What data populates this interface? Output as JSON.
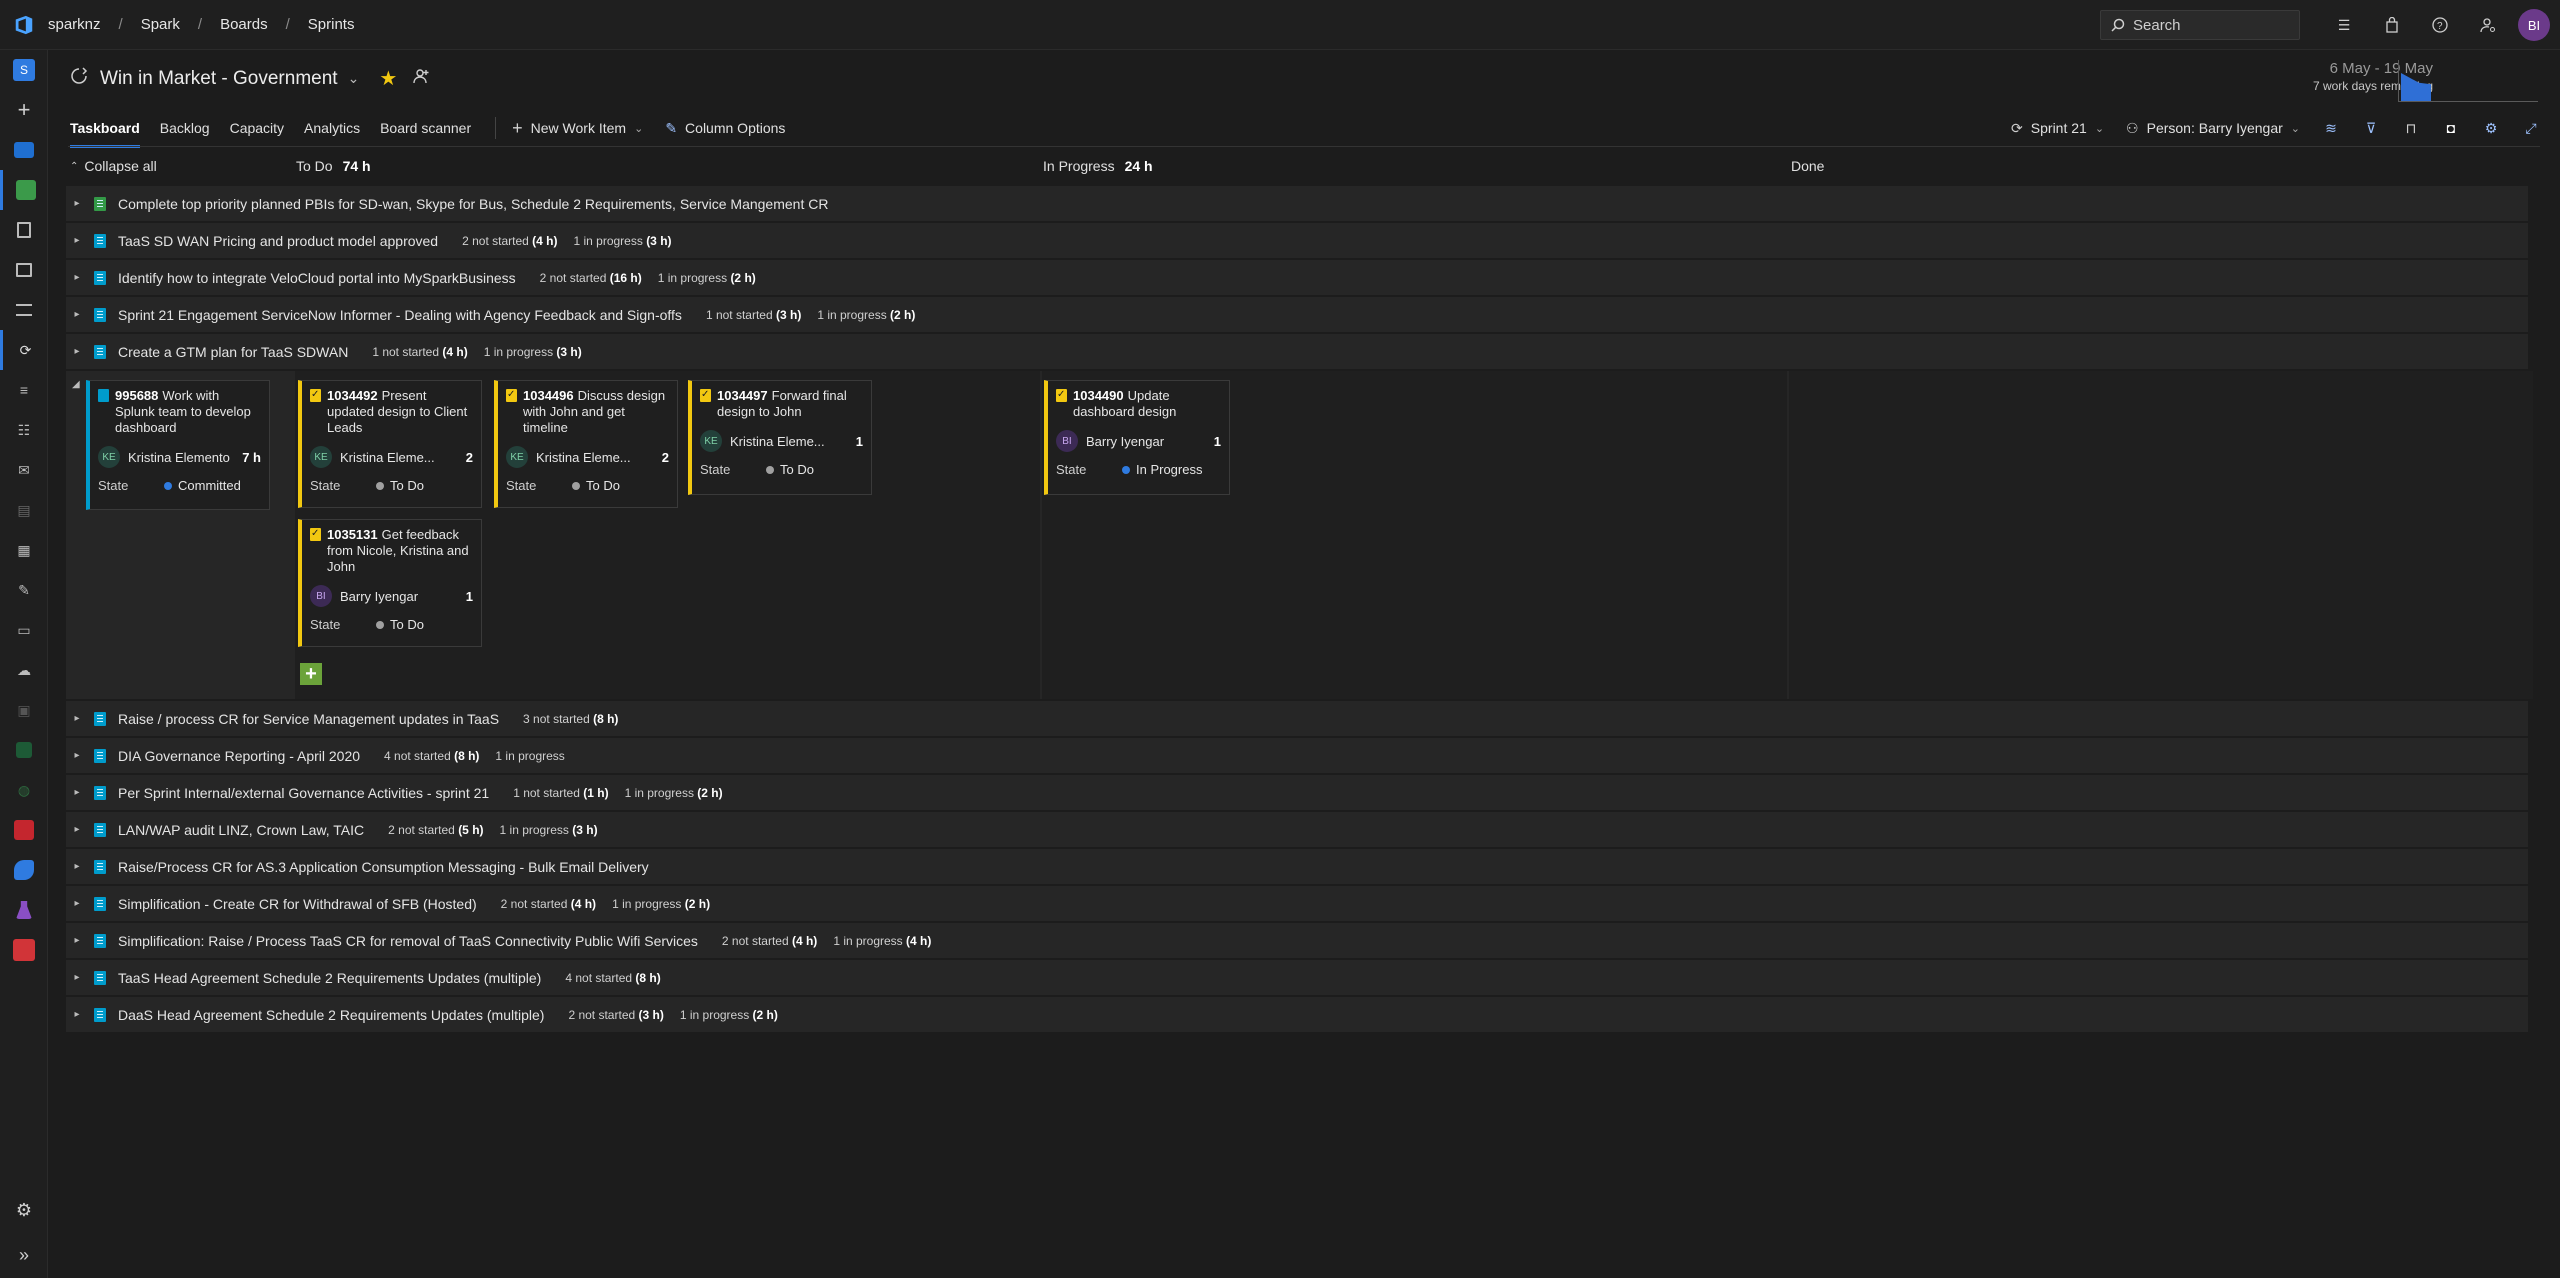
{
  "breadcrumb": {
    "org": "sparknz",
    "project": "Spark",
    "section": "Boards",
    "page": "Sprints"
  },
  "search": {
    "placeholder": "Search"
  },
  "user": {
    "initials": "BI"
  },
  "team": {
    "name": "Win in Market - Government"
  },
  "sprint_info": {
    "dates": "6 May - 19 May",
    "remaining": "7 work days remaining"
  },
  "tabs": [
    "Taskboard",
    "Backlog",
    "Capacity",
    "Analytics",
    "Board scanner"
  ],
  "toolbar": {
    "new_work_item": "New Work Item",
    "column_options": "Column Options",
    "sprint": "Sprint 21",
    "person": "Person: Barry Iyengar"
  },
  "columns": {
    "collapse_all": "Collapse all",
    "todo": {
      "label": "To Do",
      "hours": "74 h"
    },
    "inprogress": {
      "label": "In Progress",
      "hours": "24 h"
    },
    "done": {
      "label": "Done"
    }
  },
  "rows_before": [
    {
      "title": "Complete top priority planned PBIs for SD-wan, Skype for Bus, Schedule 2 Requirements, Service Mangement CR",
      "green": true,
      "ns": "",
      "nsh": "",
      "ip": "",
      "iph": ""
    },
    {
      "title": "TaaS SD WAN Pricing and product model approved",
      "ns": "2 not started",
      "nsh": "(4 h)",
      "ip": "1 in progress",
      "iph": "(3 h)"
    },
    {
      "title": "Identify how to integrate VeloCloud portal into MySparkBusiness",
      "ns": "2 not started",
      "nsh": "(16 h)",
      "ip": "1 in progress",
      "iph": "(2 h)"
    },
    {
      "title": "Sprint 21 Engagement ServiceNow Informer - Dealing with Agency Feedback and Sign-offs",
      "ns": "1 not started",
      "nsh": "(3 h)",
      "ip": "1 in progress",
      "iph": "(2 h)"
    },
    {
      "title": "Create a GTM plan for TaaS SDWAN",
      "ns": "1 not started",
      "nsh": "(4 h)",
      "ip": "1 in progress",
      "iph": "(3 h)"
    }
  ],
  "expanded": {
    "pbi": {
      "id": "995688",
      "title": "Work with Splunk team to develop dashboard",
      "initials": "KE",
      "assignee": "Kristina Elemento",
      "remaining": "7 h",
      "state_label": "State",
      "state": "Committed"
    },
    "tasks": [
      {
        "id": "1034492",
        "title": "Present updated design to Client Leads",
        "initials": "KE",
        "assignee": "Kristina Eleme...",
        "remaining": "2",
        "state_label": "State",
        "state": "To Do"
      },
      {
        "id": "1034496",
        "title": "Discuss design with John and get timeline",
        "initials": "KE",
        "assignee": "Kristina Eleme...",
        "remaining": "2",
        "state_label": "State",
        "state": "To Do"
      },
      {
        "id": "1034497",
        "title": "Forward final design to John",
        "initials": "KE",
        "assignee": "Kristina Eleme...",
        "remaining": "1",
        "state_label": "State",
        "state": "To Do"
      },
      {
        "id": "1035131",
        "title": "Get feedback from Nicole, Kristina and John",
        "initials": "BI",
        "assignee": "Barry Iyengar",
        "remaining": "1",
        "state_label": "State",
        "state": "To Do"
      },
      {
        "id": "1034490",
        "title": "Update dashboard design",
        "initials": "BI",
        "assignee": "Barry Iyengar",
        "remaining": "1",
        "state_label": "State",
        "state": "In Progress"
      }
    ]
  },
  "rows_after": [
    {
      "title": "Raise / process CR for Service Management updates in TaaS",
      "ns": "3 not started",
      "nsh": "(8 h)",
      "ip": "",
      "iph": ""
    },
    {
      "title": "DIA Governance Reporting - April 2020",
      "ns": "4 not started",
      "nsh": "(8 h)",
      "ip": "1 in progress",
      "iph": ""
    },
    {
      "title": "Per Sprint Internal/external Governance Activities - sprint 21",
      "ns": "1 not started",
      "nsh": "(1 h)",
      "ip": "1 in progress",
      "iph": "(2 h)"
    },
    {
      "title": "LAN/WAP audit LINZ, Crown Law, TAIC",
      "ns": "2 not started",
      "nsh": "(5 h)",
      "ip": "1 in progress",
      "iph": "(3 h)"
    },
    {
      "title": "Raise/Process CR for AS.3 Application Consumption Messaging - Bulk Email Delivery",
      "ns": "",
      "nsh": "",
      "ip": "",
      "iph": ""
    },
    {
      "title": "Simplification - Create CR for Withdrawal of SFB (Hosted)",
      "ns": "2 not started",
      "nsh": "(4 h)",
      "ip": "1 in progress",
      "iph": "(2 h)"
    },
    {
      "title": "Simplification: Raise / Process TaaS CR for removal of TaaS Connectivity Public Wifi Services",
      "ns": "2 not started",
      "nsh": "(4 h)",
      "ip": "1 in progress",
      "iph": "(4 h)"
    },
    {
      "title": "TaaS Head Agreement Schedule 2 Requirements Updates (multiple)",
      "ns": "4 not started",
      "nsh": "(8 h)",
      "ip": "",
      "iph": ""
    },
    {
      "title": "DaaS Head Agreement Schedule 2 Requirements Updates (multiple)",
      "ns": "2 not started",
      "nsh": "(3 h)",
      "ip": "1 in progress",
      "iph": "(2 h)"
    }
  ],
  "colors": {
    "accent": "#2f7be0",
    "task": "#f2c811",
    "pbi": "#009ccc",
    "feature": "#339947",
    "add": "#6ba33a"
  },
  "leftnav_icons": [
    "org-icon",
    "add-icon",
    "overview-icon",
    "boards-icon",
    "work-items-icon",
    "boards-board-icon",
    "backlogs-icon",
    "sprints-icon",
    "queries-icon",
    "delivery-plans-icon",
    "retrospectives-icon",
    "analytics-icon",
    "grid-icon",
    "notes-icon",
    "calendar-icon",
    "cloud-icon",
    "pipelines-icon",
    "excel-icon",
    "xbox-icon",
    "repos-icon",
    "artifacts-icon",
    "test-plans-icon",
    "extensions-icon",
    "settings-icon",
    "expand-icon"
  ]
}
